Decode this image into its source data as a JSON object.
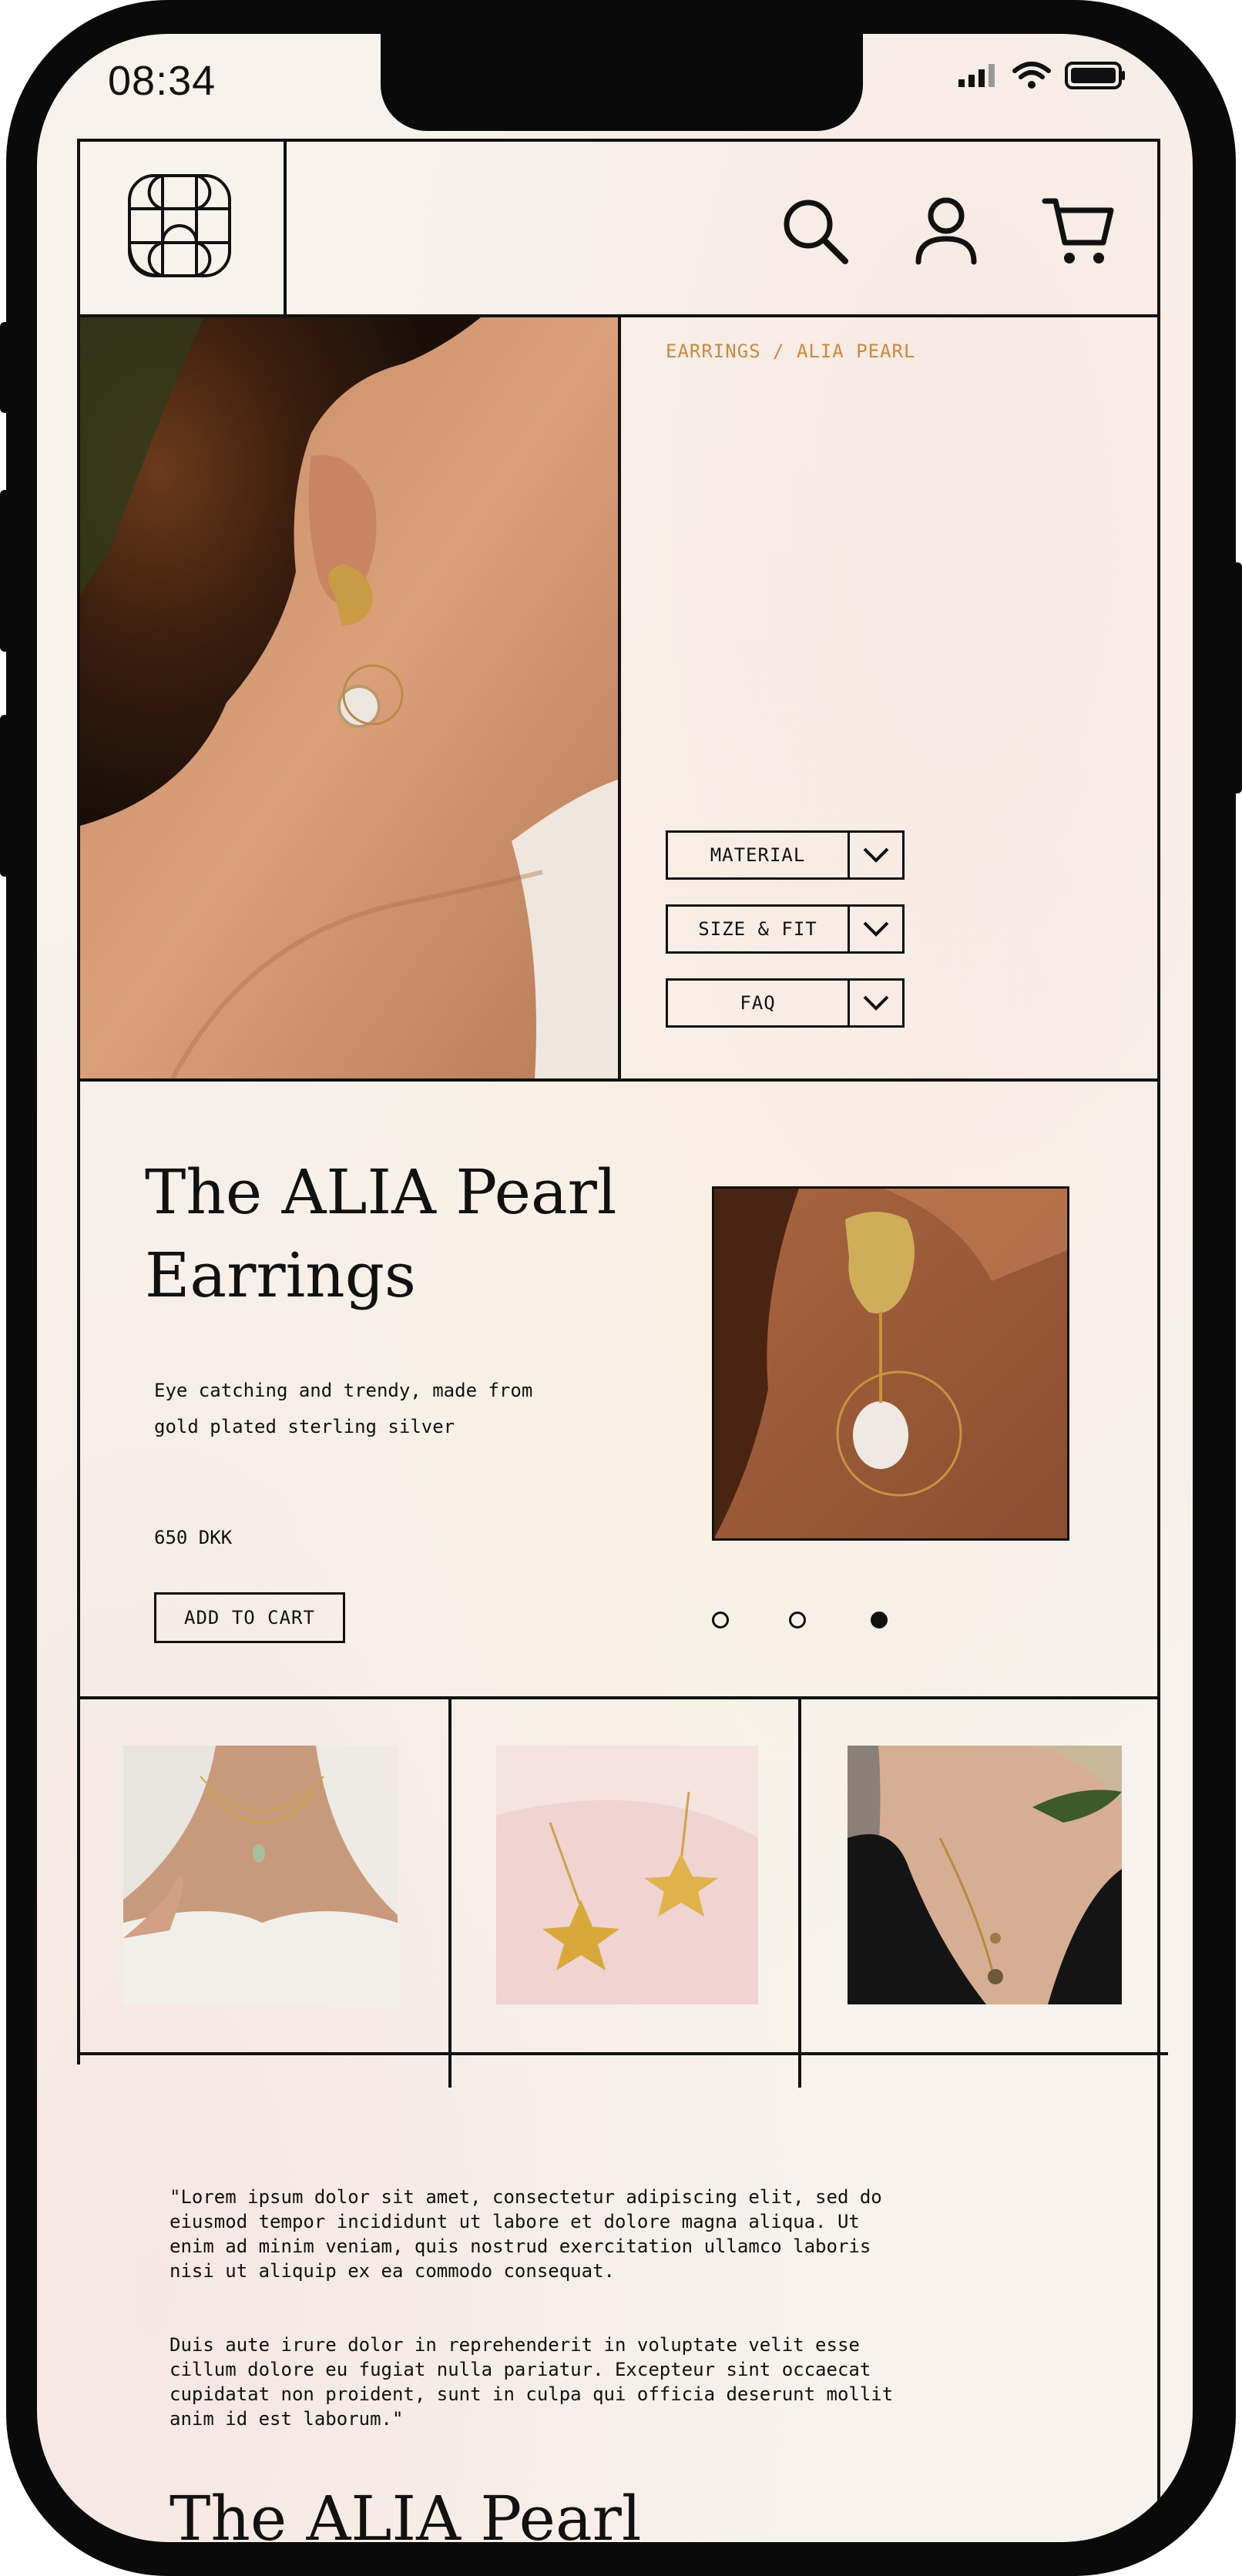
{
  "status_bar": {
    "time": "08:34"
  },
  "header": {
    "logo_icon": "grid-flower-logo",
    "search_icon": "search-icon",
    "account_icon": "user-icon",
    "cart_icon": "cart-icon"
  },
  "breadcrumb": "EARRINGS / ALIA PEARL",
  "accordion": [
    {
      "label": "MATERIAL"
    },
    {
      "label": "SIZE & FIT"
    },
    {
      "label": "FAQ"
    }
  ],
  "product": {
    "title": "The ALIA Pearl Earrings",
    "description": "Eye catching and trendy, made from gold plated sterling silver",
    "price": "650 DKK",
    "add_to_cart": "ADD TO CART",
    "carousel": {
      "count": 3,
      "active_index": 2
    }
  },
  "related": [
    {
      "name": "necklace-white-blouse"
    },
    {
      "name": "gold-star-earrings"
    },
    {
      "name": "moon-necklace"
    }
  ],
  "story": {
    "quote": "\"Lorem ipsum dolor sit amet, consectetur adipiscing elit, sed do\neiusmod tempor incididunt ut labore et dolore magna aliqua. Ut\nenim ad minim veniam, quis nostrud exercitation ullamco laboris\nnisi ut aliquip ex ea commodo consequat.\n\n\nDuis aute irure dolor in reprehenderit in voluptate velit esse\ncillum dolore eu fugiat nulla pariatur. Excepteur sint occaecat\ncupidatat non proident, sunt in culpa qui officia deserunt mollit\nanim id est laborum.\"",
    "title": "The ALIA Pearl"
  },
  "colors": {
    "accent": "#c98a3c",
    "ink": "#111111",
    "background": "#f7f2ec"
  }
}
